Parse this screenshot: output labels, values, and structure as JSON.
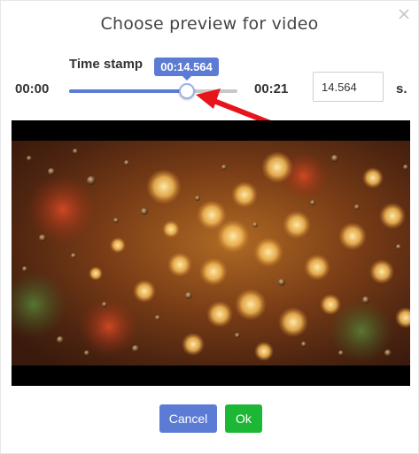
{
  "dialog": {
    "title": "Choose preview for video"
  },
  "timestamp": {
    "label": "Time stamp",
    "start_time": "00:00",
    "end_time": "00:21",
    "current_tooltip": "00:14.564",
    "slider_fraction": 0.693,
    "seconds_value": "14.564",
    "seconds_unit": "s."
  },
  "buttons": {
    "cancel_label": "Cancel",
    "ok_label": "Ok"
  },
  "colors": {
    "accent": "#5b7bd4",
    "ok": "#1cb835",
    "annotation_arrow": "#e8141c"
  },
  "icons": {
    "close": "close-icon",
    "annotation": "red-arrow-icon"
  }
}
